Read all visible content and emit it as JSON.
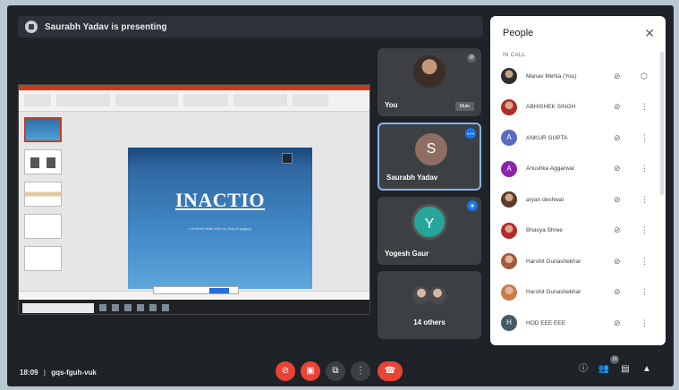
{
  "presenting": {
    "text": "Saurabh Yadav is presenting"
  },
  "slide": {
    "title": "INACTIO",
    "subtitle": "Let World Walk With Us Stay Engaging"
  },
  "tiles": {
    "you": {
      "name": "You",
      "mute_label": "Mute"
    },
    "saurabh": {
      "name": "Saurabh Yadav",
      "initial": "S"
    },
    "yogesh": {
      "name": "Yogesh Gaur",
      "initial": "Y"
    },
    "others": {
      "label": "14 others"
    }
  },
  "people_panel": {
    "title": "People",
    "section": "IN CALL",
    "participants": [
      {
        "name": "Manav Mehta (You)",
        "initial": ""
      },
      {
        "name": "ABHISHEK SINGH",
        "initial": ""
      },
      {
        "name": "ANKUR GUPTA",
        "initial": "A"
      },
      {
        "name": "Anushka Aggarwal",
        "initial": "A"
      },
      {
        "name": "aryan deshwal",
        "initial": ""
      },
      {
        "name": "Bhavya Shree",
        "initial": ""
      },
      {
        "name": "Harshit Gunashekhar",
        "initial": ""
      },
      {
        "name": "Harshit Gunashekhar",
        "initial": ""
      },
      {
        "name": "HOD EEE EEE",
        "initial": "H"
      }
    ]
  },
  "bottom": {
    "time": "18:09",
    "separator": "|",
    "meeting_code": "gqs-fguh-vuk",
    "participant_count": "18"
  },
  "colors": {
    "accent": "#1a73e8",
    "danger": "#ea4335",
    "background": "#1f2328"
  }
}
